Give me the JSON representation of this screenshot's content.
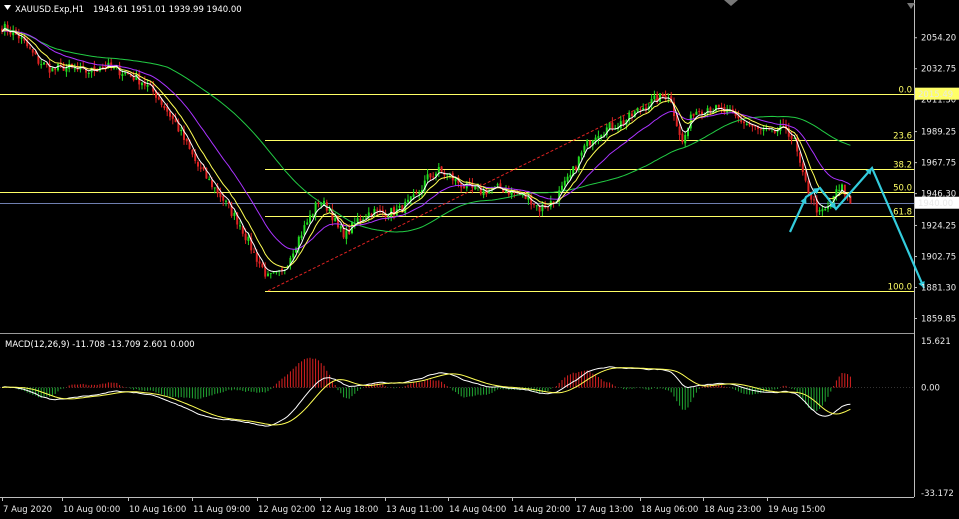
{
  "header": {
    "symbol": "XAUUSD.Exp,H1",
    "ohlc": "1943.61 1951.01 1939.99 1940.00"
  },
  "macd_header": "MACD(12,26,9) -11.708 -13.709 2.601 0.000",
  "colors": {
    "bull": "#22dd22",
    "bear": "#dd2222",
    "fib": "#ffff66",
    "ma_fast": "#ffffff",
    "ma_mid": "#ffff55",
    "ma_slow1": "#aa33ff",
    "ma_slow2": "#22cc44",
    "arrow": "#33ccdd",
    "trend": "#dd2222",
    "bid_line": "#6f7fb0"
  },
  "price_badges": {
    "fib_top": "2015.49",
    "current": "1940.00"
  },
  "chart_data": [
    {
      "type": "candlestick",
      "title": "XAUUSD.Exp,H1",
      "ylim": [
        1851.2,
        2074.1
      ],
      "y_ticks": [
        "2054.20",
        "2032.75",
        "2011.30",
        "1989.25",
        "1967.75",
        "1946.30",
        "1924.25",
        "1902.75",
        "1881.30",
        "1859.85"
      ],
      "x_ticks": [
        "7 Aug 2020",
        "10 Aug 00:00",
        "10 Aug 16:00",
        "11 Aug 09:00",
        "12 Aug 02:00",
        "12 Aug 18:00",
        "13 Aug 11:00",
        "14 Aug 04:00",
        "14 Aug 20:00",
        "17 Aug 13:00",
        "18 Aug 06:00",
        "18 Aug 23:00",
        "19 Aug 15:00"
      ],
      "close_anchors": [
        [
          0,
          2062
        ],
        [
          6,
          2055
        ],
        [
          9,
          2048
        ],
        [
          13,
          2038
        ],
        [
          18,
          2032
        ],
        [
          22,
          2034
        ],
        [
          28,
          2031
        ],
        [
          32,
          2031
        ],
        [
          35,
          2035
        ],
        [
          40,
          2033
        ],
        [
          45,
          2029
        ],
        [
          50,
          2024
        ],
        [
          55,
          2015
        ],
        [
          62,
          1995
        ],
        [
          70,
          1965
        ],
        [
          78,
          1945
        ],
        [
          85,
          1925
        ],
        [
          90,
          1905
        ],
        [
          95,
          1888
        ],
        [
          100,
          1891
        ],
        [
          105,
          1912
        ],
        [
          110,
          1930
        ],
        [
          113,
          1941
        ],
        [
          117,
          1936
        ],
        [
          120,
          1922
        ],
        [
          123,
          1918
        ],
        [
          127,
          1928
        ],
        [
          132,
          1934
        ],
        [
          138,
          1933
        ],
        [
          142,
          1935
        ],
        [
          148,
          1944
        ],
        [
          152,
          1957
        ],
        [
          156,
          1962
        ],
        [
          160,
          1958
        ],
        [
          166,
          1950
        ],
        [
          172,
          1948
        ],
        [
          178,
          1950
        ],
        [
          184,
          1946
        ],
        [
          189,
          1942
        ],
        [
          192,
          1936
        ],
        [
          197,
          1941
        ],
        [
          203,
          1958
        ],
        [
          208,
          1978
        ],
        [
          212,
          1988
        ],
        [
          218,
          1993
        ],
        [
          222,
          1996
        ],
        [
          228,
          2005
        ],
        [
          234,
          2012
        ],
        [
          238,
          2015
        ],
        [
          241,
          1996
        ],
        [
          243,
          1981
        ],
        [
          247,
          2003
        ],
        [
          252,
          2006
        ],
        [
          258,
          2003
        ],
        [
          263,
          1998
        ],
        [
          270,
          1990
        ],
        [
          275,
          1988
        ],
        [
          280,
          1992
        ],
        [
          283,
          1982
        ],
        [
          286,
          1958
        ],
        [
          289,
          1944
        ],
        [
          292,
          1932
        ],
        [
          295,
          1936
        ],
        [
          297,
          1945
        ],
        [
          300,
          1950
        ],
        [
          303,
          1940
        ]
      ],
      "fibonacci": {
        "levels": [
          {
            "label": "0.0",
            "price": 2015.49
          },
          {
            "label": "23.6",
            "price": 1983.3
          },
          {
            "label": "38.2",
            "price": 1963.3
          },
          {
            "label": "50.0",
            "price": 1947.2
          },
          {
            "label": "61.8",
            "price": 1931.1
          },
          {
            "label": "100.0",
            "price": 1879.0
          }
        ]
      },
      "current_price": 1940.0
    },
    {
      "type": "macd",
      "title": "MACD(12,26,9)",
      "params": "12,26,9",
      "values": {
        "macd": -11.708,
        "signal": -13.709,
        "histogram": 2.601,
        "zero": 0.0
      },
      "ylim": [
        -33.172,
        15.621
      ],
      "y_ticks": [
        "15.621",
        "0.00",
        "-33.172"
      ]
    }
  ]
}
